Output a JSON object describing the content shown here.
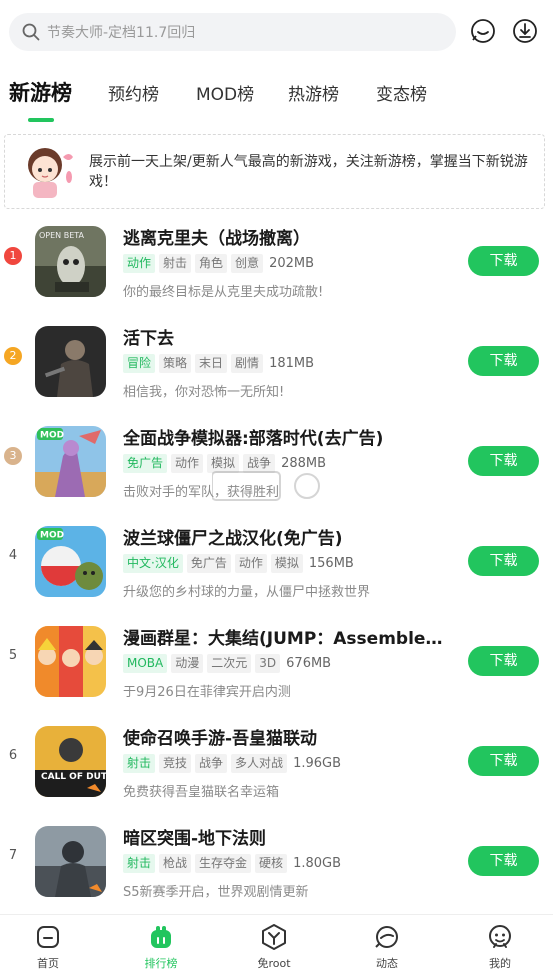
{
  "search": {
    "placeholder": "节奏大师-定档11.7回归"
  },
  "tabs": [
    {
      "label": "新游榜",
      "active": true
    },
    {
      "label": "预约榜"
    },
    {
      "label": "MOD榜"
    },
    {
      "label": "热游榜"
    },
    {
      "label": "变态榜"
    }
  ],
  "notice": {
    "text": "展示前一天上架/更新人气最高的新游戏，关注新游榜，掌握当下新锐游戏！"
  },
  "download_label": "下载",
  "rank_colors": {
    "1": "#f0473e",
    "2": "#f5a623",
    "3": "#d9b38c"
  },
  "accent_color": "#22c55e",
  "games": [
    {
      "rank": "1",
      "title": "逃离克里夫（战场撤离）",
      "tags": [
        "动作",
        "射击",
        "角色",
        "创意"
      ],
      "size": "202MB",
      "desc": "你的最终目标是从克里夫成功疏散!"
    },
    {
      "rank": "2",
      "title": "活下去",
      "tags": [
        "冒险",
        "策略",
        "末日",
        "剧情"
      ],
      "size": "181MB",
      "desc": "相信我，你对恐怖一无所知!"
    },
    {
      "rank": "3",
      "title": "全面战争模拟器:部落时代(去广告)",
      "tags": [
        "免广告",
        "动作",
        "模拟",
        "战争"
      ],
      "size": "288MB",
      "desc": "击败对手的军队，获得胜利"
    },
    {
      "rank": "4",
      "title": "波兰球僵尸之战汉化(免广告)",
      "tags": [
        "中文·汉化",
        "免广告",
        "动作",
        "模拟"
      ],
      "size": "156MB",
      "desc": "升级您的乡村球的力量，从僵尸中拯救世界"
    },
    {
      "rank": "5",
      "title": "漫画群星：大集结(JUMP：Assemble)...",
      "tags": [
        "MOBA",
        "动漫",
        "二次元",
        "3D"
      ],
      "size": "676MB",
      "desc": "于9月26日在菲律宾开启内测"
    },
    {
      "rank": "6",
      "title": "使命召唤手游-吾皇猫联动",
      "tags": [
        "射击",
        "竞技",
        "战争",
        "多人对战"
      ],
      "size": "1.96GB",
      "desc": "免费获得吾皇猫联名幸运箱"
    },
    {
      "rank": "7",
      "title": "暗区突围-地下法则",
      "tags": [
        "射击",
        "枪战",
        "生存夺金",
        "硬核"
      ],
      "size": "1.80GB",
      "desc": "S5新赛季开启，世界观剧情更新"
    }
  ],
  "icons": {
    "g1": "OPEN BETA",
    "g3": "MOD",
    "g4": "MOD",
    "g6": "CALL OF DUTY"
  },
  "bottom_nav": [
    {
      "label": "首页",
      "icon": "home-icon"
    },
    {
      "label": "排行榜",
      "icon": "ranking-icon",
      "active": true
    },
    {
      "label": "免root",
      "icon": "no-root-icon"
    },
    {
      "label": "动态",
      "icon": "feed-icon"
    },
    {
      "label": "我的",
      "icon": "profile-icon"
    }
  ]
}
